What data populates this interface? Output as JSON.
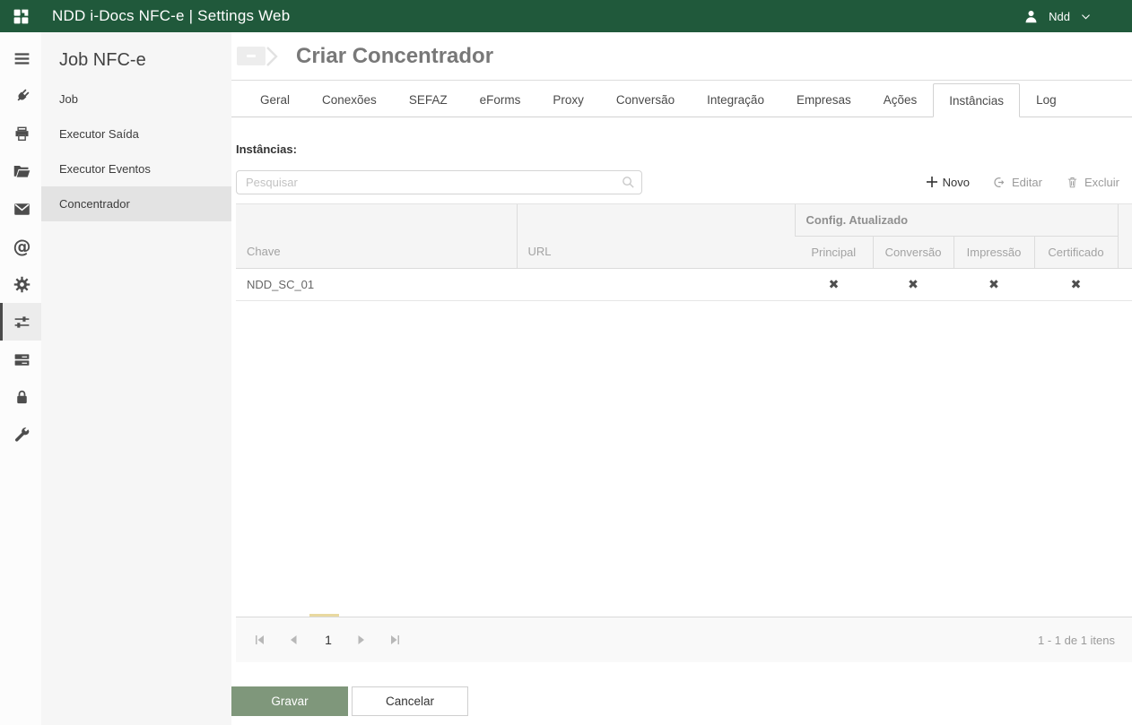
{
  "header": {
    "title": "NDD i-Docs NFC-e | Settings Web",
    "user_name": "Ndd",
    "bg_color": "#20593b"
  },
  "icon_rail": {
    "items": [
      "menu-icon",
      "plug-icon",
      "printer-icon",
      "folder-open-icon",
      "mail-icon",
      "at-icon",
      "gear-icon",
      "sliders-icon",
      "server-icon",
      "lock-icon",
      "wrench-icon"
    ],
    "active_icon": "sliders-icon",
    "at_glyph": "@"
  },
  "sidebar": {
    "title": "Job NFC-e",
    "items": [
      {
        "label": "Job",
        "active": false
      },
      {
        "label": "Executor Saída",
        "active": false
      },
      {
        "label": "Executor Eventos",
        "active": false
      },
      {
        "label": "Concentrador",
        "active": true
      }
    ]
  },
  "main": {
    "page_title": "Criar Concentrador",
    "tabs": [
      {
        "label": "Geral",
        "active": false
      },
      {
        "label": "Conexões",
        "active": false
      },
      {
        "label": "SEFAZ",
        "active": false
      },
      {
        "label": "eForms",
        "active": false
      },
      {
        "label": "Proxy",
        "active": false
      },
      {
        "label": "Conversão",
        "active": false
      },
      {
        "label": "Integração",
        "active": false
      },
      {
        "label": "Empresas",
        "active": false
      },
      {
        "label": "Ações",
        "active": false
      },
      {
        "label": "Instâncias",
        "active": true
      },
      {
        "label": "Log",
        "active": false
      }
    ],
    "section_label": "Instâncias:",
    "search": {
      "placeholder": "Pesquisar"
    },
    "toolbar": {
      "novo_label": "Novo",
      "editar_label": "Editar",
      "excluir_label": "Excluir"
    },
    "table": {
      "col_chave": "Chave",
      "col_url": "URL",
      "col_group": "Config. Atualizado",
      "sub_principal": "Principal",
      "sub_conversao": "Conversão",
      "sub_impressao": "Impressão",
      "sub_certificado": "Certificado",
      "rows": [
        {
          "chave": "NDD_SC_01",
          "url": "",
          "principal": "✖",
          "conversao": "✖",
          "impressao": "✖",
          "certificado": "✖"
        }
      ]
    },
    "pager": {
      "current_page": "1",
      "info": "1 - 1 de 1 itens"
    },
    "footer": {
      "gravar_label": "Gravar",
      "cancelar_label": "Cancelar"
    }
  }
}
